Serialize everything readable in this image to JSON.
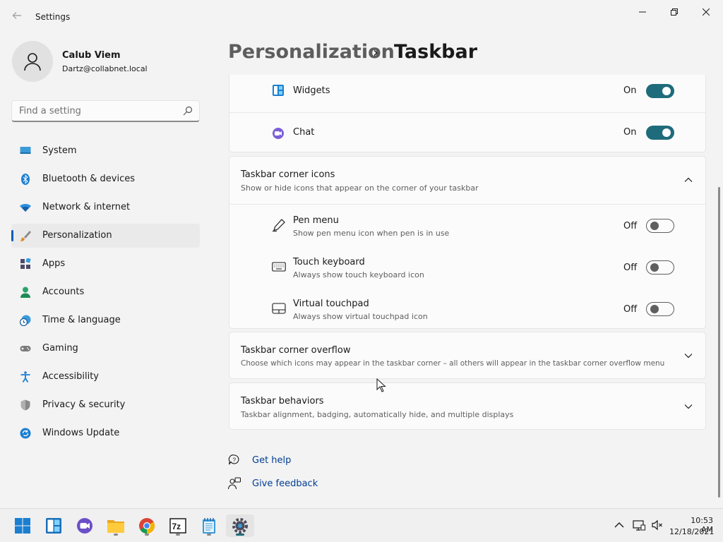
{
  "window": {
    "title": "Settings",
    "back_icon": "back-arrow-icon",
    "minimize_icon": "minimize-icon",
    "maximize_icon": "restore-icon",
    "close_icon": "close-icon"
  },
  "profile": {
    "name": "Calub Viem",
    "email": "Dartz@collabnet.local"
  },
  "search": {
    "placeholder": "Find a setting",
    "icon": "search-icon"
  },
  "nav": {
    "items": [
      {
        "label": "System",
        "icon": "monitor-icon",
        "selected": false
      },
      {
        "label": "Bluetooth & devices",
        "icon": "bluetooth-icon",
        "selected": false
      },
      {
        "label": "Network & internet",
        "icon": "wifi-icon",
        "selected": false
      },
      {
        "label": "Personalization",
        "icon": "brush-icon",
        "selected": true
      },
      {
        "label": "Apps",
        "icon": "apps-icon",
        "selected": false
      },
      {
        "label": "Accounts",
        "icon": "person-icon",
        "selected": false
      },
      {
        "label": "Time & language",
        "icon": "globe-clock-icon",
        "selected": false
      },
      {
        "label": "Gaming",
        "icon": "gamepad-icon",
        "selected": false
      },
      {
        "label": "Accessibility",
        "icon": "accessibility-icon",
        "selected": false
      },
      {
        "label": "Privacy & security",
        "icon": "shield-icon",
        "selected": false
      },
      {
        "label": "Windows Update",
        "icon": "update-icon",
        "selected": false
      }
    ]
  },
  "breadcrumb": {
    "parent": "Personalization",
    "separator": "›",
    "current": "Taskbar"
  },
  "taskbar_items": {
    "widgets": {
      "label": "Widgets",
      "state": "On",
      "on": true,
      "icon": "widgets-icon"
    },
    "chat": {
      "label": "Chat",
      "state": "On",
      "on": true,
      "icon": "chat-icon"
    }
  },
  "corner_icons": {
    "title": "Taskbar corner icons",
    "subtitle": "Show or hide icons that appear on the corner of your taskbar",
    "expanded": true,
    "items": [
      {
        "label": "Pen menu",
        "desc": "Show pen menu icon when pen is in use",
        "state": "Off",
        "on": false,
        "icon": "pen-icon"
      },
      {
        "label": "Touch keyboard",
        "desc": "Always show touch keyboard icon",
        "state": "Off",
        "on": false,
        "icon": "keyboard-icon"
      },
      {
        "label": "Virtual touchpad",
        "desc": "Always show virtual touchpad icon",
        "state": "Off",
        "on": false,
        "icon": "touchpad-icon"
      }
    ]
  },
  "corner_overflow": {
    "title": "Taskbar corner overflow",
    "subtitle": "Choose which icons may appear in the taskbar corner – all others will appear in the taskbar corner overflow menu"
  },
  "behaviors": {
    "title": "Taskbar behaviors",
    "subtitle": "Taskbar alignment, badging, automatically hide, and multiple displays"
  },
  "help": {
    "get_help": "Get help",
    "give_feedback": "Give feedback"
  },
  "taskbar": {
    "apps": [
      "start-icon",
      "widgets-icon",
      "chat-icon",
      "file-explorer-icon",
      "chrome-icon",
      "7zip-icon",
      "notepad-icon",
      "settings-icon"
    ],
    "time": "10:53 AM",
    "date": "12/18/2021"
  },
  "colors": {
    "accent": "#1e6b7b",
    "selection_bar": "#005fb8",
    "link": "#003e92"
  }
}
